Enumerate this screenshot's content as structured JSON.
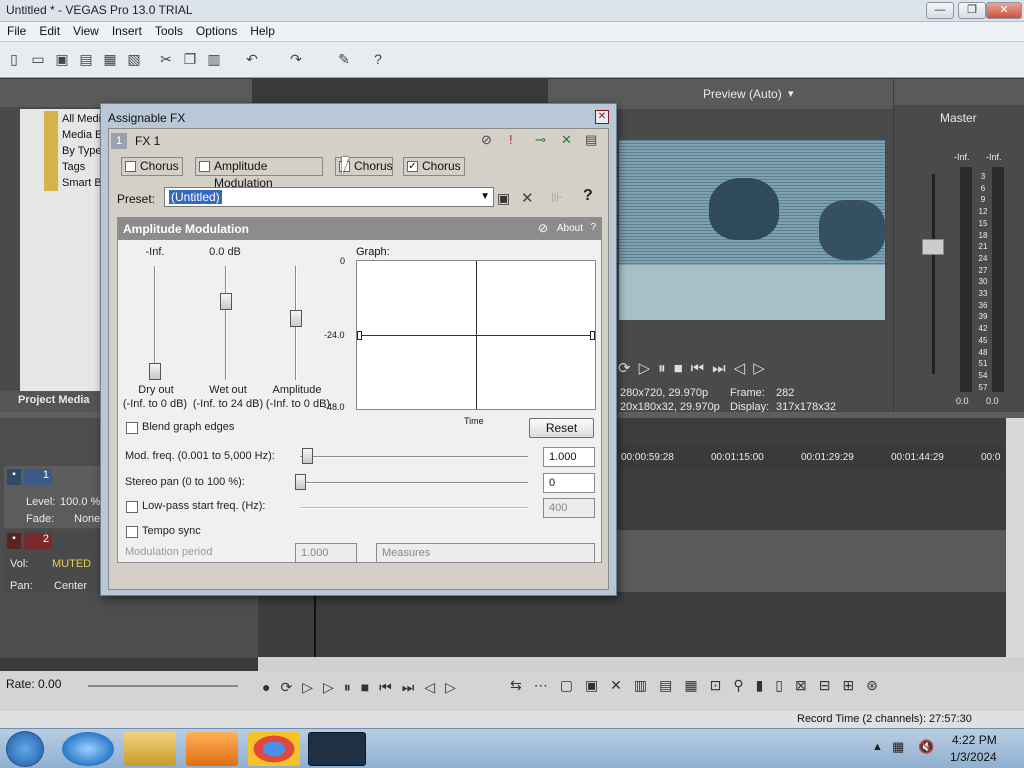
{
  "window": {
    "title": "Untitled * - VEGAS Pro 13.0 TRIAL",
    "min": "—",
    "max": "❐",
    "close": "✕"
  },
  "menu": [
    "File",
    "Edit",
    "View",
    "Insert",
    "Tools",
    "Options",
    "Help"
  ],
  "explorer": {
    "items": [
      "All Media",
      "Media B",
      "By Type",
      "Tags",
      "Smart B"
    ],
    "tab_label": "Project Media"
  },
  "dialog": {
    "title": "Assignable FX",
    "fx_label": "FX 1",
    "fx_num": "1",
    "chain": [
      {
        "label": "Chorus",
        "checked": false
      },
      {
        "label": "Amplitude Modulation",
        "checked": false
      },
      {
        "label": "Chorus",
        "checked": false
      },
      {
        "label": "Chorus",
        "checked": true
      }
    ],
    "preset_label": "Preset:",
    "preset_value": "(Untitled)",
    "plugin": {
      "name": "Amplitude Modulation",
      "about": "About",
      "help": "?",
      "sliders": [
        {
          "top": "-Inf.",
          "label1": "Dry out",
          "label2": "(-Inf. to 0 dB)",
          "level": 0.0
        },
        {
          "top": "0.0 dB",
          "label1": "Wet out",
          "label2": "(-Inf. to 24 dB)",
          "level": 0.72
        },
        {
          "top": "",
          "label1": "Amplitude",
          "label2": "(-Inf. to 0 dB)",
          "level": 0.55
        }
      ],
      "graph_label": "Graph:",
      "graph_ticks": [
        "0",
        "-24.0",
        "-48.0"
      ],
      "graph_xlabel": "Time",
      "blend_label": "Blend graph edges",
      "reset": "Reset",
      "mod_freq_label": "Mod. freq. (0.001 to 5,000 Hz):",
      "mod_freq_value": "1.000",
      "stereo_pan_label": "Stereo pan  (0 to 100 %):",
      "stereo_pan_value": "0",
      "lowpass_label": "Low-pass start freq. (Hz):",
      "lowpass_value": "400",
      "tempo_label": "Tempo sync",
      "mod_period_label": "Modulation period",
      "mod_period_value": "1.000",
      "measures": "Measures"
    }
  },
  "preview": {
    "quality": "Preview (Auto)",
    "info_left1": "280x720, 29.970p",
    "info_left2": "20x180x32, 29.970p",
    "frame_label": "Frame:",
    "frame_value": "282",
    "display_label": "Display:",
    "display_value": "317x178x32"
  },
  "master": {
    "title": "Master",
    "left_peak": "-Inf.",
    "right_peak": "-Inf.",
    "scale": [
      "3",
      "6",
      "9",
      "12",
      "15",
      "18",
      "21",
      "24",
      "27",
      "30",
      "33",
      "36",
      "39",
      "42",
      "45",
      "48",
      "51",
      "54",
      "57"
    ],
    "bottom_left": "0.0",
    "bottom_right": "0.0"
  },
  "tracks": [
    {
      "num": "1",
      "l1": "Level:",
      "v1": "100.0 %",
      "l2": "Fade:",
      "v2": "None"
    },
    {
      "num": "2",
      "l1": "Vol:",
      "v1": "MUTED",
      "l2": "Pan:",
      "v2": "Center"
    }
  ],
  "timeline": {
    "ticks": [
      "00:00:59:28",
      "00:01:15:00",
      "00:01:29:29",
      "00:01:44:29",
      "00:0"
    ]
  },
  "transport": {
    "rate": "Rate: 0.00"
  },
  "status": {
    "record_time": "Record Time (2 channels): 27:57:30"
  },
  "tray": {
    "time": "4:22 PM",
    "date": "1/3/2024"
  }
}
